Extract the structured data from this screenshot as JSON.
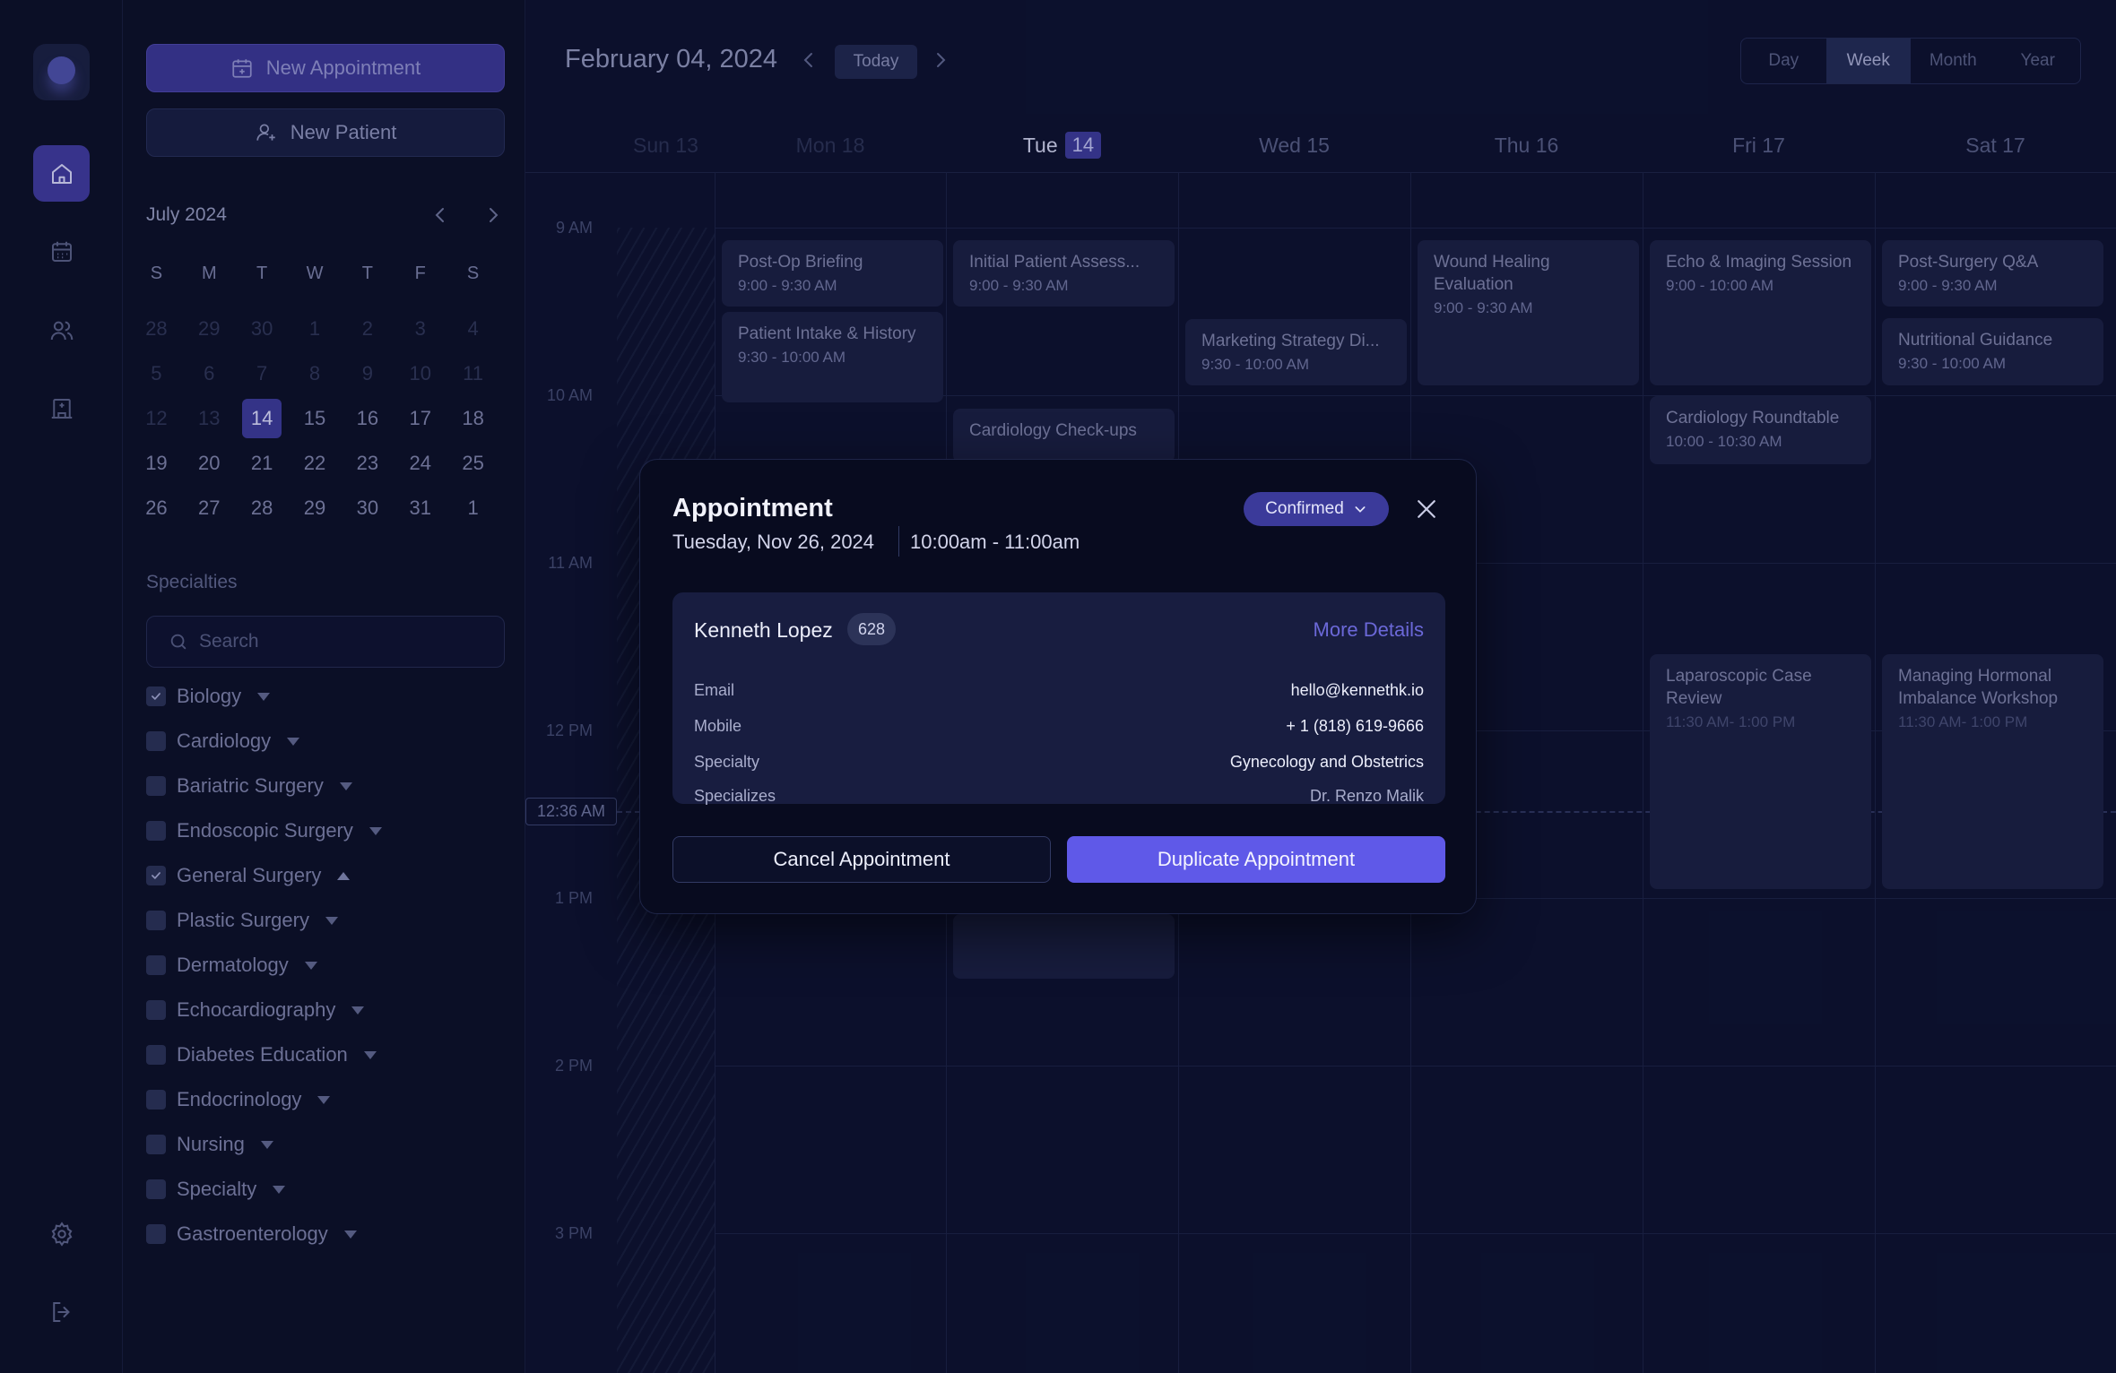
{
  "rail": {
    "items": [
      "home-icon",
      "calendar-icon",
      "users-icon",
      "hospital-icon"
    ],
    "bottom": [
      "settings-icon",
      "logout-icon"
    ]
  },
  "sidebar": {
    "new_appointment": "New Appointment",
    "new_patient": "New Patient",
    "mini_calendar": {
      "title": "July  2024",
      "weekdays": [
        "S",
        "M",
        "T",
        "W",
        "T",
        "F",
        "S"
      ],
      "weeks": [
        [
          "28",
          "29",
          "30",
          "1",
          "2",
          "3",
          "4"
        ],
        [
          "5",
          "6",
          "7",
          "8",
          "9",
          "10",
          "11"
        ],
        [
          "12",
          "13",
          "14",
          "15",
          "16",
          "17",
          "18"
        ],
        [
          "19",
          "20",
          "21",
          "22",
          "23",
          "24",
          "25"
        ],
        [
          "26",
          "27",
          "28",
          "29",
          "30",
          "31",
          "1"
        ]
      ],
      "selected": "14"
    },
    "specialties_title": "Specialties",
    "search_placeholder": "Search",
    "specialties": [
      {
        "label": "Biology",
        "checked": true,
        "expanded": false
      },
      {
        "label": "Cardiology",
        "checked": false,
        "expanded": false
      },
      {
        "label": "Bariatric Surgery",
        "checked": false,
        "expanded": false
      },
      {
        "label": "Endoscopic Surgery",
        "checked": false,
        "expanded": false
      },
      {
        "label": "General Surgery",
        "checked": true,
        "expanded": true
      },
      {
        "label": "Plastic Surgery",
        "checked": false,
        "expanded": false
      },
      {
        "label": "Dermatology",
        "checked": false,
        "expanded": false
      },
      {
        "label": "Echocardiography",
        "checked": false,
        "expanded": false
      },
      {
        "label": "Diabetes Education",
        "checked": false,
        "expanded": false
      },
      {
        "label": "Endocrinology",
        "checked": false,
        "expanded": false
      },
      {
        "label": "Nursing",
        "checked": false,
        "expanded": false
      },
      {
        "label": "Specialty",
        "checked": false,
        "expanded": false
      },
      {
        "label": "Gastroenterology",
        "checked": false,
        "expanded": false
      }
    ]
  },
  "calendar": {
    "date_title": "February 04, 2024",
    "today_label": "Today",
    "views": [
      "Day",
      "Week",
      "Month",
      "Year"
    ],
    "active_view": "Week",
    "days": [
      {
        "label": "Sun 13",
        "badge": ""
      },
      {
        "label": "Mon 18",
        "badge": ""
      },
      {
        "label": "Tue",
        "badge": "14"
      },
      {
        "label": "Wed 15",
        "badge": ""
      },
      {
        "label": "Thu 16",
        "badge": ""
      },
      {
        "label": "Fri 17",
        "badge": ""
      },
      {
        "label": "Sat 17",
        "badge": ""
      }
    ],
    "hours": [
      "9 AM",
      "10 AM",
      "11 AM",
      "12 PM",
      "1 PM",
      "2 PM",
      "3 PM"
    ],
    "now_label": "12:36 AM",
    "events": [
      {
        "day": 1,
        "title": "Post-Op Briefing",
        "time": "9:00 - 9:30 AM"
      },
      {
        "day": 1,
        "title": "Patient Intake & History",
        "time": "9:30 - 10:00 AM"
      },
      {
        "day": 2,
        "title": "Initial Patient Assess...",
        "time": "9:00 - 9:30 AM"
      },
      {
        "day": 2,
        "title": "Cardiology Check-ups",
        "time": ""
      },
      {
        "day": 2,
        "title": "",
        "time": ""
      },
      {
        "day": 3,
        "title": "Marketing Strategy Di...",
        "time": "9:30 - 10:00 AM"
      },
      {
        "day": 4,
        "title": "Wound Healing Evaluation",
        "time": "9:00 - 9:30 AM"
      },
      {
        "day": 5,
        "title": "Echo & Imaging Session",
        "time": "9:00 - 10:00 AM"
      },
      {
        "day": 5,
        "title": "Cardiology Roundtable",
        "time": "10:00 - 10:30 AM"
      },
      {
        "day": 5,
        "title": "Laparoscopic Case Review",
        "time": "11:30 AM- 1:00 PM"
      },
      {
        "day": 6,
        "title": "Post-Surgery Q&A",
        "time": "9:00 - 9:30 AM"
      },
      {
        "day": 6,
        "title": "Nutritional Guidance",
        "time": "9:30 - 10:00 AM"
      },
      {
        "day": 6,
        "title": "Managing Hormonal Imbalance Workshop",
        "time": "11:30 AM- 1:00 PM"
      }
    ]
  },
  "modal": {
    "title": "Appointment",
    "date": "Tuesday, Nov 26, 2024",
    "time": "10:00am  -  11:00am",
    "status": "Confirmed",
    "patient": {
      "name": "Kenneth Lopez",
      "id": "628",
      "more_details": "More Details",
      "fields": [
        {
          "label": "Email",
          "value": "hello@kennethk.io"
        },
        {
          "label": "Mobile",
          "value": "+ 1 (818) 619-9666"
        },
        {
          "label": "Specialty",
          "value": "Gynecology and Obstetrics"
        },
        {
          "label": "Specializes",
          "value": "Dr. Renzo Malik"
        }
      ]
    },
    "cancel_label": "Cancel Appointment",
    "duplicate_label": "Duplicate Appointment"
  },
  "colors": {
    "accent": "#5f59e8",
    "status": "#3b3a9a",
    "background": "#0d1230"
  }
}
